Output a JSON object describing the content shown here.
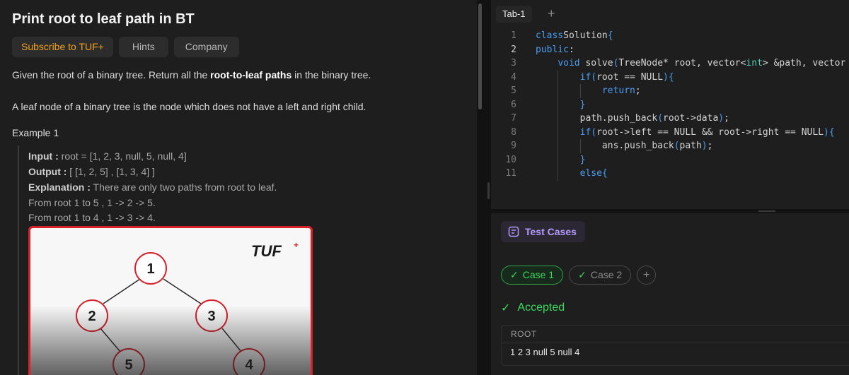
{
  "problem": {
    "title": "Print root to leaf path in BT",
    "chips": [
      "Subscribe to TUF+",
      "Hints",
      "Company"
    ],
    "desc1_pre": "Given the root of a binary tree. Return all the ",
    "desc1_bold": "root-to-leaf paths",
    "desc1_post": " in the binary tree.",
    "desc2": "A leaf node of a binary tree is the node which does not have a left and right child.",
    "example_title": "Example 1",
    "example": {
      "input_key": "Input :",
      "input_val": " root = [1, 2, 3, null, 5, null, 4]",
      "output_key": "Output :",
      "output_val": " [ [1, 2, 5] , [1, 3, 4] ]",
      "expl_key": "Explanation :",
      "expl_val": " There are only two paths from root to leaf.",
      "line4": "From root 1 to 5 , 1 -> 2 -> 5.",
      "line5": "From root 1 to 4 , 1 -> 3 -> 4."
    },
    "image": {
      "logo": "TUF",
      "nodes": [
        "1",
        "2",
        "3",
        "5",
        "4"
      ]
    }
  },
  "editor": {
    "tab": "Tab-1",
    "add_tab": "+",
    "current_line": 2,
    "lines": [
      {
        "n": "1",
        "parts": [
          [
            "kw",
            "class"
          ],
          [
            "",
            "Solution"
          ],
          [
            "kw",
            "{"
          ]
        ]
      },
      {
        "n": "2",
        "parts": [
          [
            "kw",
            "public"
          ],
          [
            "",
            ":"
          ]
        ]
      },
      {
        "n": "3",
        "parts": [
          [
            "",
            "    "
          ],
          [
            "kw",
            "void"
          ],
          [
            "",
            " solve"
          ],
          [
            "kw",
            "("
          ],
          [
            "",
            "TreeNode* root, vector"
          ],
          [
            "",
            ""
          ],
          [
            "",
            "<"
          ],
          [
            "ty",
            "int"
          ],
          [
            "",
            "> &path, vector"
          ]
        ]
      },
      {
        "n": "4",
        "parts": [
          [
            "",
            "        "
          ],
          [
            "kw",
            "if"
          ],
          [
            "kw",
            "("
          ],
          [
            "",
            "root == NULL"
          ],
          [
            "kw",
            ")"
          ],
          [
            "kw",
            "{"
          ]
        ]
      },
      {
        "n": "5",
        "parts": [
          [
            "",
            "            "
          ],
          [
            "kw",
            "return"
          ],
          [
            "",
            ";"
          ]
        ]
      },
      {
        "n": "6",
        "parts": [
          [
            "",
            "        "
          ],
          [
            "kw",
            "}"
          ]
        ]
      },
      {
        "n": "7",
        "parts": [
          [
            "",
            "        path.push_back"
          ],
          [
            "kw",
            "("
          ],
          [
            "",
            "root->data"
          ],
          [
            "kw",
            ")"
          ],
          [
            "",
            ";"
          ]
        ]
      },
      {
        "n": "8",
        "parts": [
          [
            "",
            "        "
          ],
          [
            "kw",
            "if"
          ],
          [
            "kw",
            "("
          ],
          [
            "",
            "root->left == NULL && root->right == NULL"
          ],
          [
            "kw",
            ")"
          ],
          [
            "kw",
            "{"
          ]
        ]
      },
      {
        "n": "9",
        "parts": [
          [
            "",
            "            ans.push_back"
          ],
          [
            "kw",
            "("
          ],
          [
            "",
            "path"
          ],
          [
            "kw",
            ")"
          ],
          [
            "",
            ";"
          ]
        ]
      },
      {
        "n": "10",
        "parts": [
          [
            "",
            "        "
          ],
          [
            "kw",
            "}"
          ]
        ]
      },
      {
        "n": "11",
        "parts": [
          [
            "",
            "        "
          ],
          [
            "kw",
            "else"
          ],
          [
            "kw",
            "{"
          ]
        ]
      }
    ]
  },
  "tests": {
    "button": "Test Cases",
    "case1": "Case 1",
    "case2": "Case 2",
    "add": "+",
    "status": "Accepted",
    "field_label": "ROOT",
    "field_value": "1 2 3 null 5 null 4"
  },
  "colors": {
    "accent_green": "#3ad65f",
    "brand_red": "#d8202a",
    "subscribe": "#f0a21b",
    "test_purple": "#b49cff"
  }
}
